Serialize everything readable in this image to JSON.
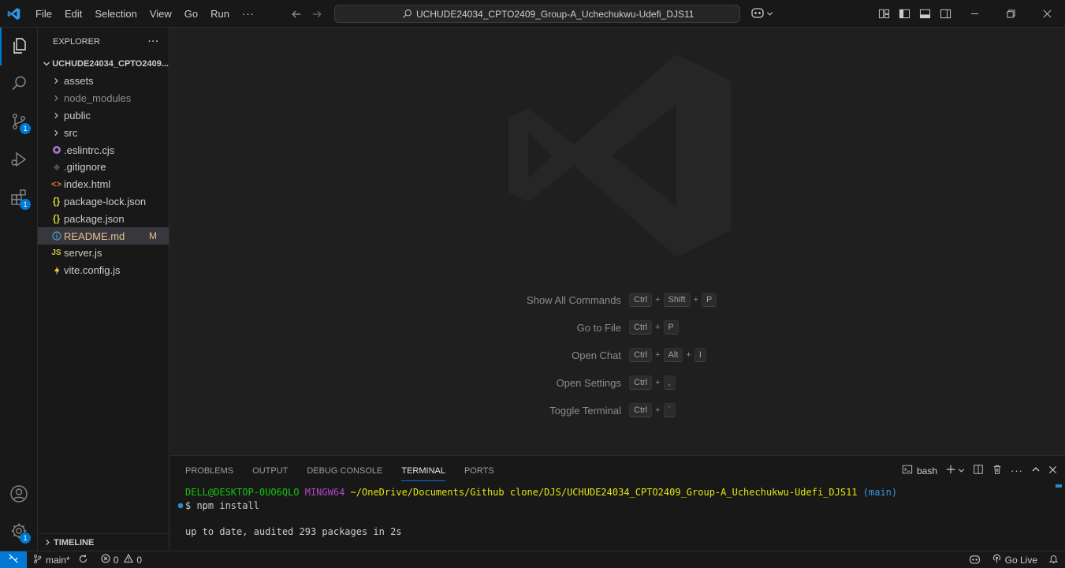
{
  "titlebar": {
    "menus": [
      "File",
      "Edit",
      "Selection",
      "View",
      "Go",
      "Run"
    ],
    "more": "···",
    "command_center": "UCHUDE24034_CPTO2409_Group-A_Uchechukwu-Udefi_DJS11"
  },
  "activitybar": {
    "items": [
      {
        "name": "explorer-icon",
        "badge": ""
      },
      {
        "name": "search-icon",
        "badge": ""
      },
      {
        "name": "source-control-icon",
        "badge": "1"
      },
      {
        "name": "run-debug-icon",
        "badge": ""
      },
      {
        "name": "extensions-icon",
        "badge": "1"
      }
    ],
    "bottom": [
      "account-icon",
      "manage-gear-icon"
    ],
    "gear_badge": "1"
  },
  "sidebar": {
    "header": "EXPLORER",
    "header_more": "···",
    "folder": "UCHUDE24034_CPTO2409...",
    "items": [
      {
        "label": "assets",
        "type": "folder",
        "icon": "chevron-right-icon"
      },
      {
        "label": "node_modules",
        "type": "folder",
        "icon": "chevron-right-icon",
        "dim": true
      },
      {
        "label": "public",
        "type": "folder",
        "icon": "chevron-right-icon"
      },
      {
        "label": "src",
        "type": "folder",
        "icon": "chevron-right-icon"
      },
      {
        "label": ".eslintrc.cjs",
        "type": "file",
        "icon": "eslint-file-icon"
      },
      {
        "label": ".gitignore",
        "type": "file",
        "icon": "git-file-icon"
      },
      {
        "label": "index.html",
        "type": "file",
        "icon": "html-file-icon"
      },
      {
        "label": "package-lock.json",
        "type": "file",
        "icon": "json-file-icon"
      },
      {
        "label": "package.json",
        "type": "file",
        "icon": "json-file-icon"
      },
      {
        "label": "README.md",
        "type": "file",
        "icon": "info-file-icon",
        "status": "M",
        "selected": true
      },
      {
        "label": "server.js",
        "type": "file",
        "icon": "js-file-icon"
      },
      {
        "label": "vite.config.js",
        "type": "file",
        "icon": "vite-file-icon"
      }
    ],
    "timeline": "TIMELINE"
  },
  "editor": {
    "shortcuts": [
      {
        "label": "Show All Commands",
        "keys": [
          "Ctrl",
          "Shift",
          "P"
        ]
      },
      {
        "label": "Go to File",
        "keys": [
          "Ctrl",
          "P"
        ]
      },
      {
        "label": "Open Chat",
        "keys": [
          "Ctrl",
          "Alt",
          "I"
        ]
      },
      {
        "label": "Open Settings",
        "keys": [
          "Ctrl",
          ","
        ]
      },
      {
        "label": "Toggle Terminal",
        "keys": [
          "Ctrl",
          "`"
        ]
      }
    ]
  },
  "panel": {
    "tabs": [
      "PROBLEMS",
      "OUTPUT",
      "DEBUG CONSOLE",
      "TERMINAL",
      "PORTS"
    ],
    "active_tab": "TERMINAL",
    "shell": "bash",
    "terminal": {
      "user": "DELL@DESKTOP-0UO6QLO",
      "env": "MINGW64",
      "path": "~/OneDrive/Documents/Github clone/DJS/UCHUDE24034_CPTO2409_Group-A_Uchechukwu-Udefi_DJS11",
      "branch": "(main)",
      "command": "$ npm install",
      "output": "up to date, audited 293 packages in 2s"
    }
  },
  "statusbar": {
    "branch": "main*",
    "errors": "0",
    "warnings": "0",
    "go_live": "Go Live"
  },
  "colors": {
    "accent": "#0078d4",
    "modified": "#e2c08d",
    "background": "#1f1f1f",
    "chrome": "#181818"
  }
}
